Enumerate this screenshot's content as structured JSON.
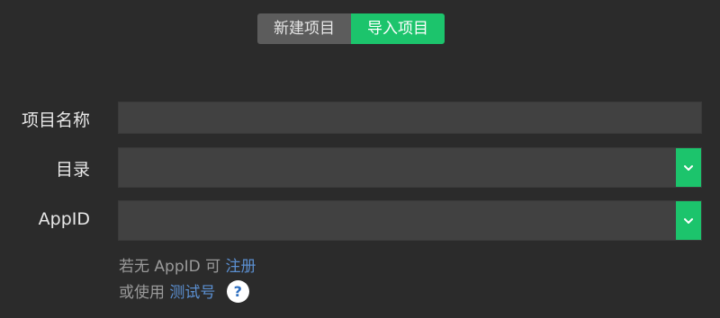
{
  "tabs": {
    "new_project": "新建项目",
    "import_project": "导入项目",
    "active": "import_project"
  },
  "form": {
    "project_name": {
      "label": "项目名称",
      "value": ""
    },
    "directory": {
      "label": "目录",
      "value": ""
    },
    "appid": {
      "label": "AppID",
      "value": ""
    }
  },
  "hints": {
    "line1_prefix": "若无 AppID 可",
    "register_link": "注册",
    "line2_prefix": "或使用",
    "test_account_link": "测试号",
    "help_symbol": "?"
  },
  "colors": {
    "background": "#2b2b2b",
    "accent": "#1cc46c",
    "inactive_tab": "#5c5c5c",
    "field": "#414141",
    "link": "#5b8fd0"
  },
  "icons": {
    "dropdown": "chevron-down-icon",
    "help": "question-mark-icon"
  }
}
